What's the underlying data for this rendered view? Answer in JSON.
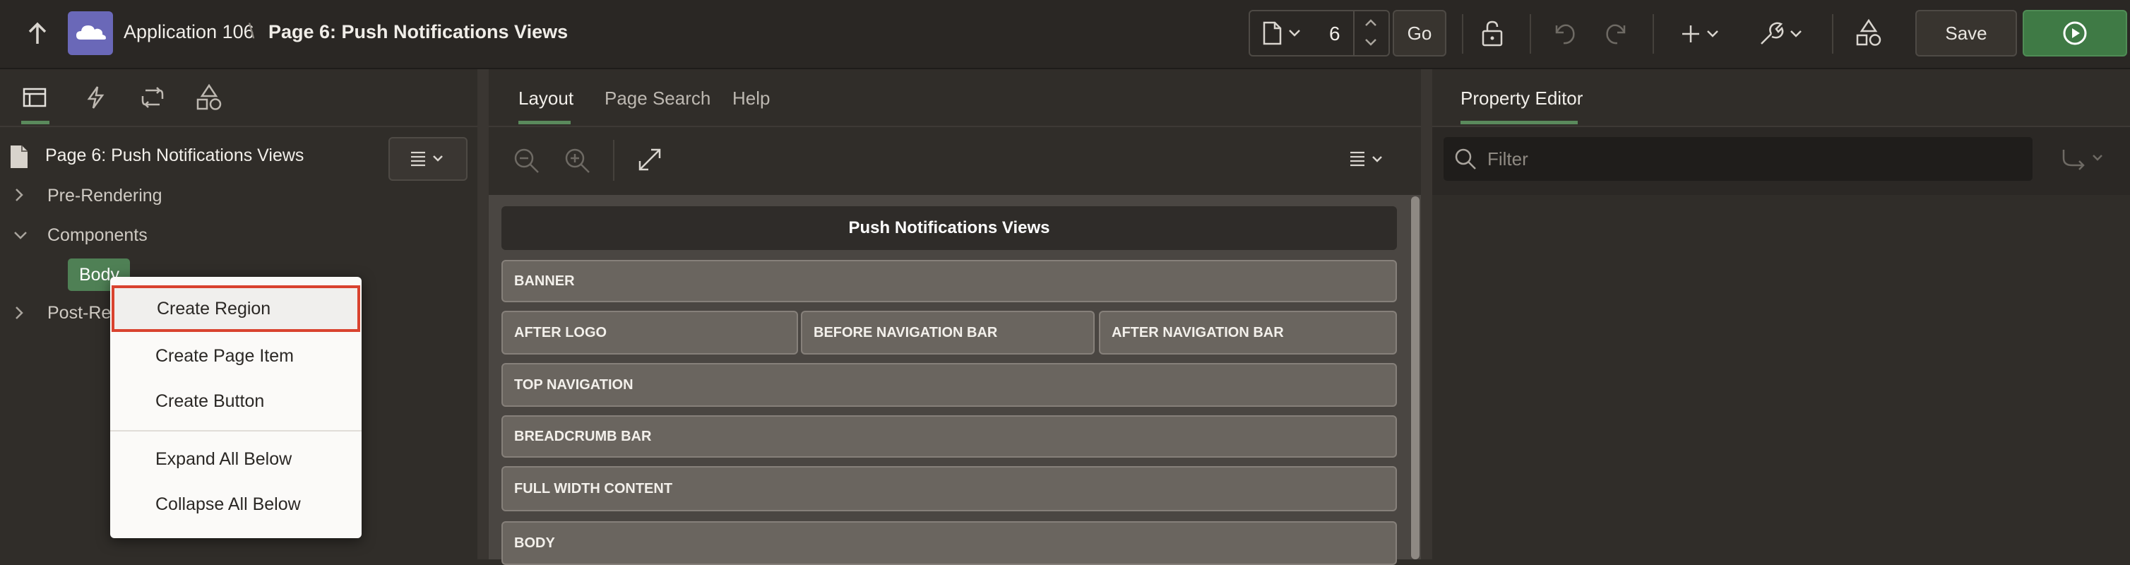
{
  "header": {
    "app_name": "Application 106",
    "breadcrumb_sep": "\\",
    "page_title": "Page 6: Push Notifications Views",
    "page_number": "6",
    "go_label": "Go",
    "save_label": "Save"
  },
  "left": {
    "root_label": "Page 6: Push Notifications Views",
    "items": [
      {
        "label": "Pre-Rendering"
      },
      {
        "label": "Components"
      },
      {
        "label": "Body"
      },
      {
        "label": "Post-Re"
      }
    ]
  },
  "context_menu": {
    "items": [
      "Create Region",
      "Create Page Item",
      "Create Button",
      "Expand All Below",
      "Collapse All Below"
    ]
  },
  "center": {
    "tabs": [
      "Layout",
      "Page Search",
      "Help"
    ],
    "layout_title": "Push Notifications Views",
    "regions": {
      "banner": "BANNER",
      "after_logo": "AFTER LOGO",
      "before_nav": "BEFORE NAVIGATION BAR",
      "after_nav": "AFTER NAVIGATION BAR",
      "top_nav": "TOP NAVIGATION",
      "breadcrumb": "BREADCRUMB BAR",
      "full_width": "FULL WIDTH CONTENT",
      "body": "BODY"
    }
  },
  "right": {
    "tab": "Property Editor",
    "filter_placeholder": "Filter"
  },
  "colors": {
    "accent_green": "#5a8a5c",
    "run_button": "#3f7a45",
    "menu_highlight_border": "#d9432f"
  }
}
